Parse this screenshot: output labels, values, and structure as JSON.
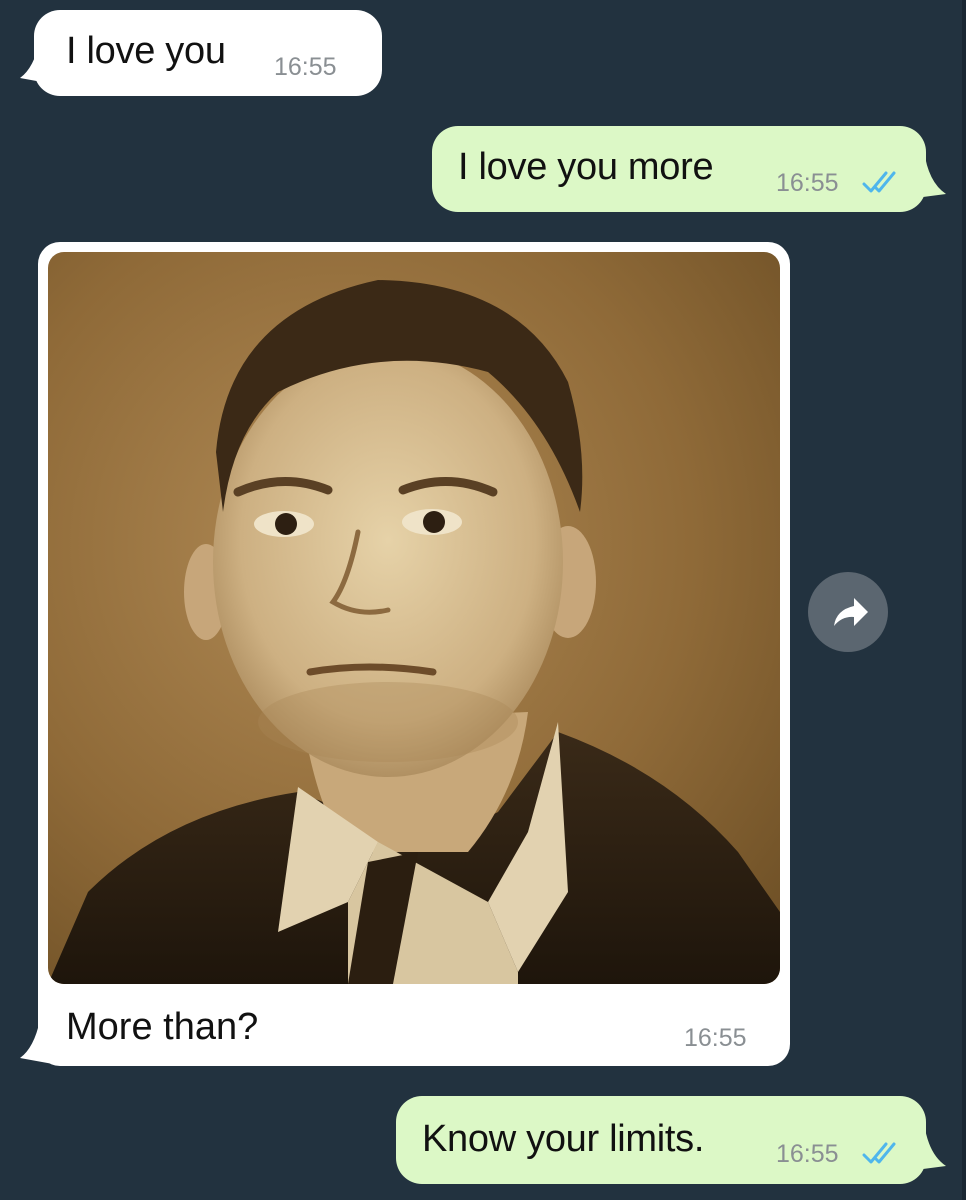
{
  "chat": {
    "messages": [
      {
        "direction": "incoming",
        "type": "text",
        "text": "I love you",
        "time": "16:55"
      },
      {
        "direction": "outgoing",
        "type": "text",
        "text": "I love you more",
        "time": "16:55",
        "status": "read"
      },
      {
        "direction": "incoming",
        "type": "image",
        "image_subject": "sepia portrait of a man in a dark suit and tie",
        "caption": "More than?",
        "time": "16:55"
      },
      {
        "direction": "outgoing",
        "type": "text",
        "text": "Know your limits.",
        "time": "16:55",
        "status": "read"
      }
    ]
  },
  "colors": {
    "background": "#22323f",
    "incoming_bubble": "#ffffff",
    "outgoing_bubble": "#dcf8c6",
    "read_ticks": "#4fb6ec",
    "timestamp": "#8a8f93"
  },
  "icons": {
    "forward": "forward-arrow-icon",
    "read_status": "double-check-icon"
  }
}
